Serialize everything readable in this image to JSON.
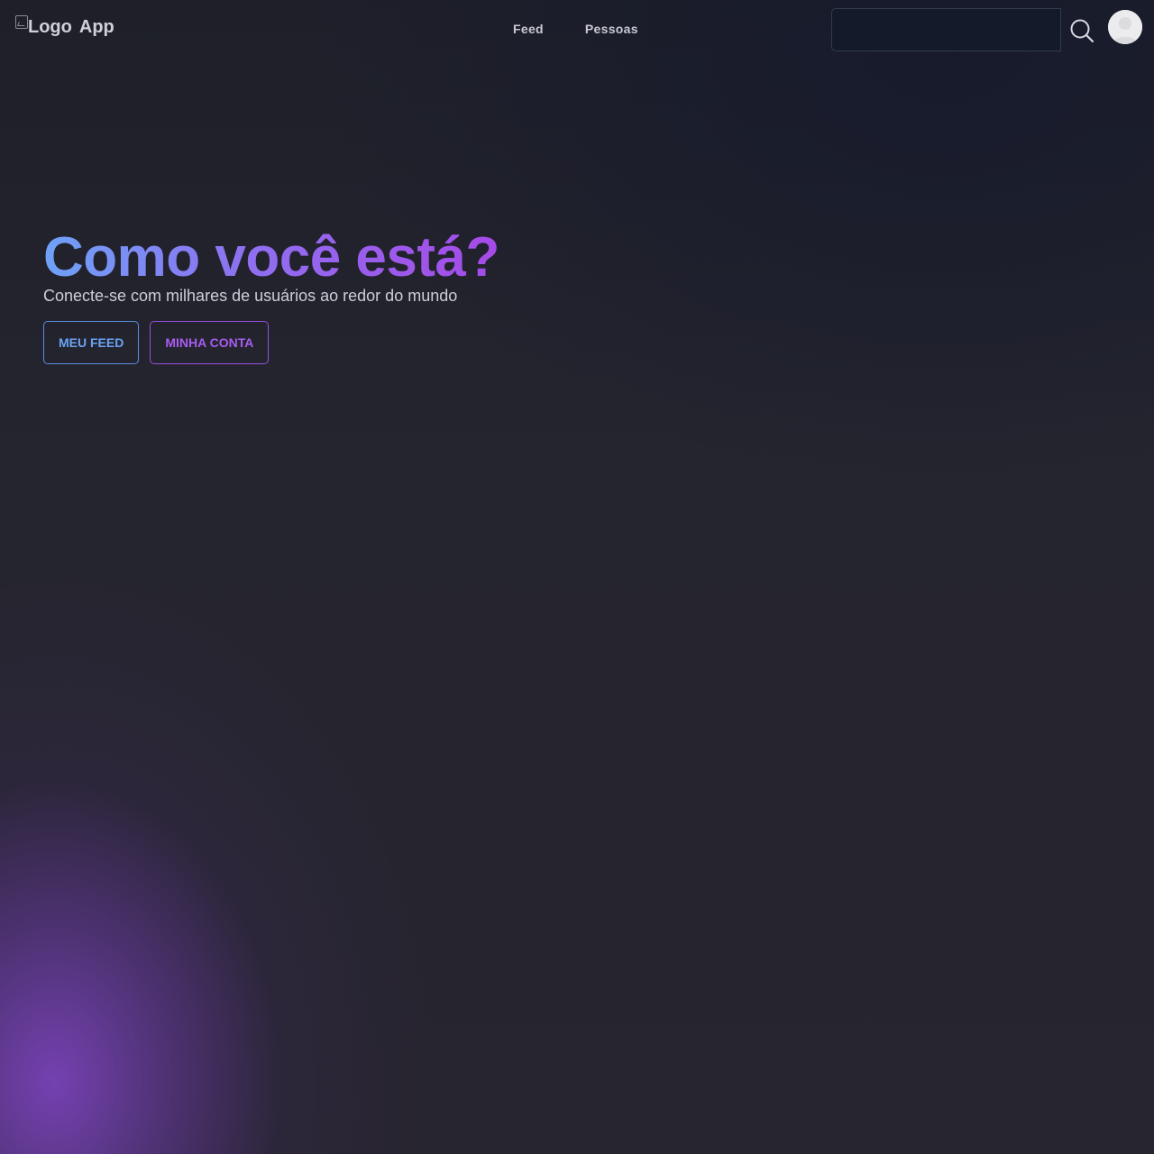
{
  "header": {
    "logo_alt": "Logo",
    "app_name": "App",
    "nav": {
      "feed": "Feed",
      "people": "Pessoas"
    },
    "search": {
      "value": "",
      "placeholder": ""
    },
    "search_icon": "search-icon",
    "avatar_icon": "user-avatar-icon"
  },
  "hero": {
    "title": "Como você está?",
    "subtitle": "Conecte-se com milhares de usuários ao redor do mundo",
    "buttons": {
      "feed": "MEU FEED",
      "account": "MINHA CONTA"
    }
  },
  "colors": {
    "accent_blue": "#6aa4f4",
    "accent_purple": "#a95cf0",
    "background": "#25252f",
    "glow": "#7a44c0"
  }
}
